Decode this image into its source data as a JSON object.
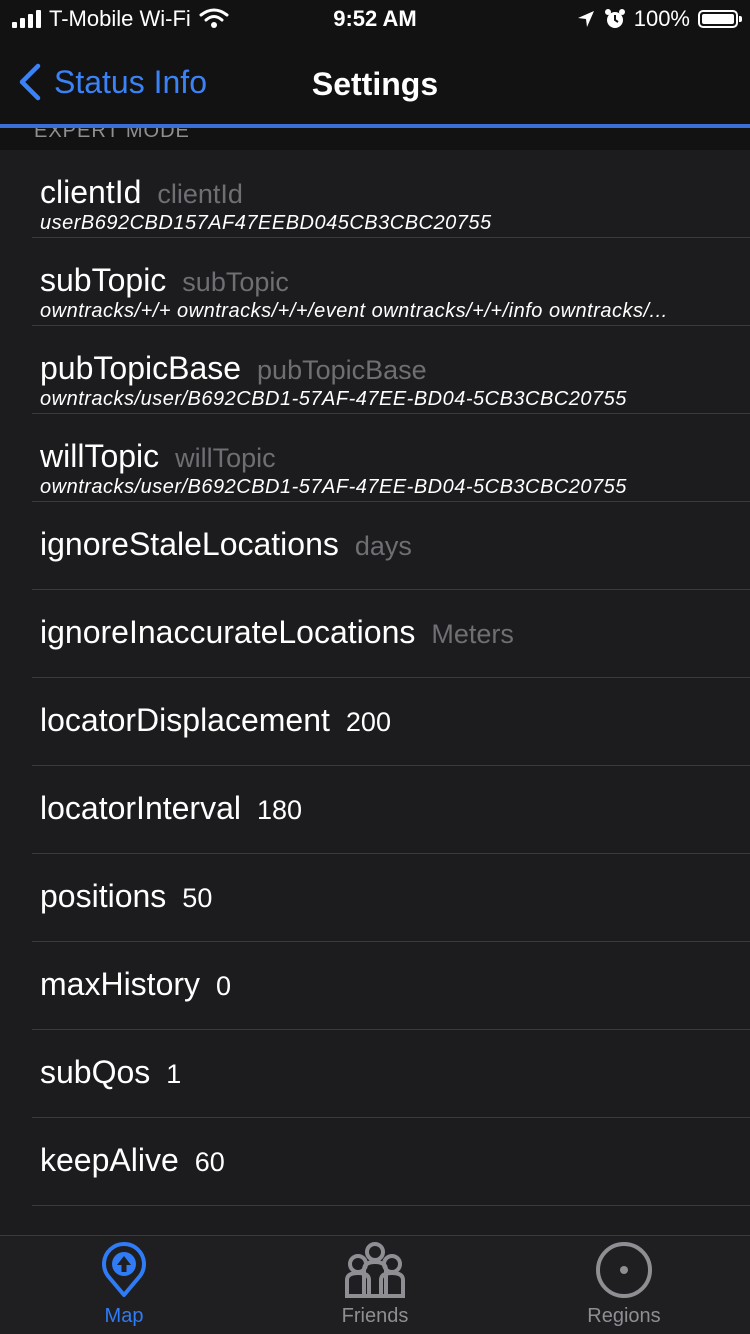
{
  "status_bar": {
    "carrier": "T-Mobile Wi-Fi",
    "time": "9:52 AM",
    "battery": "100%",
    "icons": [
      "signal-icon",
      "wifi-icon",
      "location-arrow-icon",
      "alarm-icon",
      "battery-icon"
    ]
  },
  "nav": {
    "back_label": "Status Info",
    "title": "Settings"
  },
  "section_header": "EXPERT MODE",
  "rows": [
    {
      "key": "clientId",
      "value": "",
      "placeholder": "clientId",
      "detail": "userB692CBD157AF47EEBD045CB3CBC20755"
    },
    {
      "key": "subTopic",
      "value": "",
      "placeholder": "subTopic",
      "detail": "owntracks/+/+ owntracks/+/+/event owntracks/+/+/info owntracks/..."
    },
    {
      "key": "pubTopicBase",
      "value": "",
      "placeholder": "pubTopicBase",
      "detail": "owntracks/user/B692CBD1-57AF-47EE-BD04-5CB3CBC20755"
    },
    {
      "key": "willTopic",
      "value": "",
      "placeholder": "willTopic",
      "detail": "owntracks/user/B692CBD1-57AF-47EE-BD04-5CB3CBC20755"
    },
    {
      "key": "ignoreStaleLocations",
      "value": "",
      "placeholder": "days",
      "detail": ""
    },
    {
      "key": "ignoreInaccurateLocations",
      "value": "",
      "placeholder": "Meters",
      "detail": ""
    },
    {
      "key": "locatorDisplacement",
      "value": "200",
      "placeholder": "",
      "detail": ""
    },
    {
      "key": "locatorInterval",
      "value": "180",
      "placeholder": "",
      "detail": ""
    },
    {
      "key": "positions",
      "value": "50",
      "placeholder": "",
      "detail": ""
    },
    {
      "key": "maxHistory",
      "value": "0",
      "placeholder": "",
      "detail": ""
    },
    {
      "key": "subQos",
      "value": "1",
      "placeholder": "",
      "detail": ""
    },
    {
      "key": "keepAlive",
      "value": "60",
      "placeholder": "",
      "detail": ""
    }
  ],
  "tabs": [
    {
      "label": "Map",
      "icon": "map-pin-icon",
      "selected": true
    },
    {
      "label": "Friends",
      "icon": "friends-icon",
      "selected": false
    },
    {
      "label": "Regions",
      "icon": "regions-icon",
      "selected": false
    }
  ],
  "colors": {
    "accent": "#2f7cf6",
    "background": "#1c1c1e",
    "separator": "#3a3a3c",
    "placeholder": "#6e6e73"
  }
}
